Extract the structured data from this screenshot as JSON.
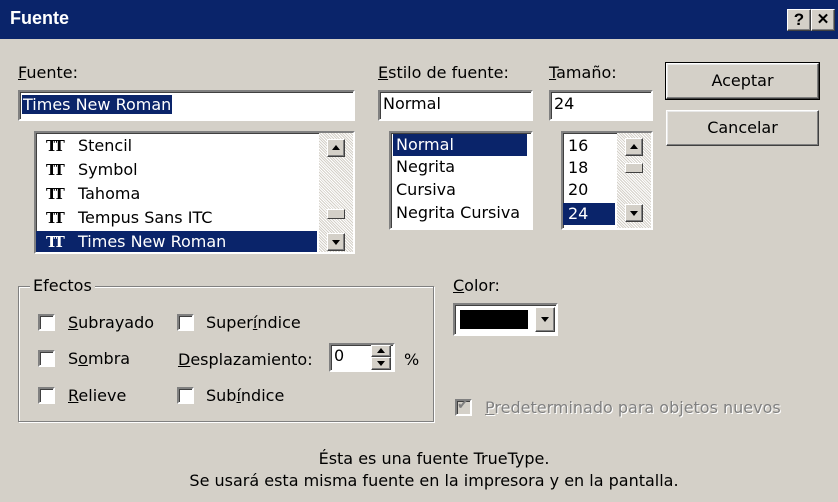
{
  "window": {
    "title": "Fuente",
    "help_glyph": "?",
    "close_glyph": "✕"
  },
  "font": {
    "label": "Fuente:",
    "value": "Times New Roman",
    "list": [
      "Stencil",
      "Symbol",
      "Tahoma",
      "Tempus Sans ITC",
      "Times New Roman"
    ],
    "selected_index": 4
  },
  "style": {
    "label": "Estilo de fuente:",
    "value": "Normal",
    "list": [
      "Normal",
      "Negrita",
      "Cursiva",
      "Negrita Cursiva"
    ],
    "selected_index": 0
  },
  "size": {
    "label": "Tamaño:",
    "value": "24",
    "list": [
      "16",
      "18",
      "20",
      "24"
    ],
    "selected_index": 3
  },
  "buttons": {
    "accept": "Aceptar",
    "cancel": "Cancelar"
  },
  "effects": {
    "group_label": "Efectos",
    "underline": "Subrayado",
    "shadow": "Sombra",
    "relief": "Relieve",
    "superscript": "Superíndice",
    "offset_label": "Desplazamiento:",
    "offset_value": "0",
    "offset_unit": "%",
    "subscript": "Subíndice"
  },
  "color": {
    "label": "Color:",
    "swatch": "#000000"
  },
  "default_checkbox": {
    "label": "Predeterminado para objetos nuevos",
    "checked": true,
    "enabled": false
  },
  "info": {
    "line1": "Ésta es una fuente TrueType.",
    "line2": "Se usará esta misma fuente en la impresora y en la pantalla."
  },
  "colors": {
    "titlebar": "#0a246a",
    "face": "#d4d0c8",
    "selection": "#0a246a"
  }
}
